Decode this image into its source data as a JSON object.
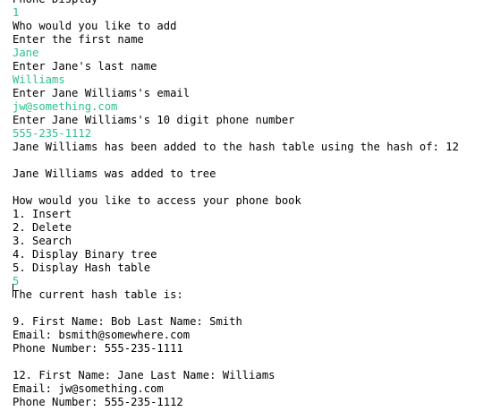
{
  "console": {
    "lines": [
      {
        "text": "Phone Display",
        "kind": "output"
      },
      {
        "text": "1",
        "kind": "input"
      },
      {
        "text": "Who would you like to add",
        "kind": "output"
      },
      {
        "text": "Enter the first name",
        "kind": "output"
      },
      {
        "text": "Jane",
        "kind": "input"
      },
      {
        "text": "Enter Jane's last name",
        "kind": "output"
      },
      {
        "text": "Williams",
        "kind": "input"
      },
      {
        "text": "Enter Jane Williams's email",
        "kind": "output"
      },
      {
        "text": "jw@something.com",
        "kind": "input"
      },
      {
        "text": "Enter Jane Williams's 10 digit phone number",
        "kind": "output"
      },
      {
        "text": "555-235-1112",
        "kind": "input"
      },
      {
        "text": "Jane Williams has been added to the hash table using the hash of: 12",
        "kind": "output"
      },
      {
        "text": "",
        "kind": "output"
      },
      {
        "text": "Jane Williams was added to tree",
        "kind": "output"
      },
      {
        "text": "",
        "kind": "output"
      },
      {
        "text": "How would you like to access your phone book",
        "kind": "output"
      },
      {
        "text": "1. Insert",
        "kind": "output"
      },
      {
        "text": "2. Delete",
        "kind": "output"
      },
      {
        "text": "3. Search",
        "kind": "output"
      },
      {
        "text": "4. Display Binary tree",
        "kind": "output"
      },
      {
        "text": "5. Display Hash table",
        "kind": "output"
      },
      {
        "text": "5",
        "kind": "input"
      },
      {
        "text": "The current hash table is:",
        "kind": "output"
      },
      {
        "text": "",
        "kind": "output"
      },
      {
        "text": "9. First Name: Bob Last Name: Smith",
        "kind": "output"
      },
      {
        "text": "Email: bsmith@somewhere.com",
        "kind": "output"
      },
      {
        "text": "Phone Number: 555-235-1111",
        "kind": "output"
      },
      {
        "text": "",
        "kind": "output"
      },
      {
        "text": "12. First Name: Jane Last Name: Williams",
        "kind": "output"
      },
      {
        "text": "Email: jw@something.com",
        "kind": "output"
      },
      {
        "text": "Phone Number: 555-235-1112",
        "kind": "output"
      }
    ]
  },
  "colors": {
    "input_text": "#2ec08a",
    "output_text": "#000000",
    "background": "#ffffff"
  }
}
